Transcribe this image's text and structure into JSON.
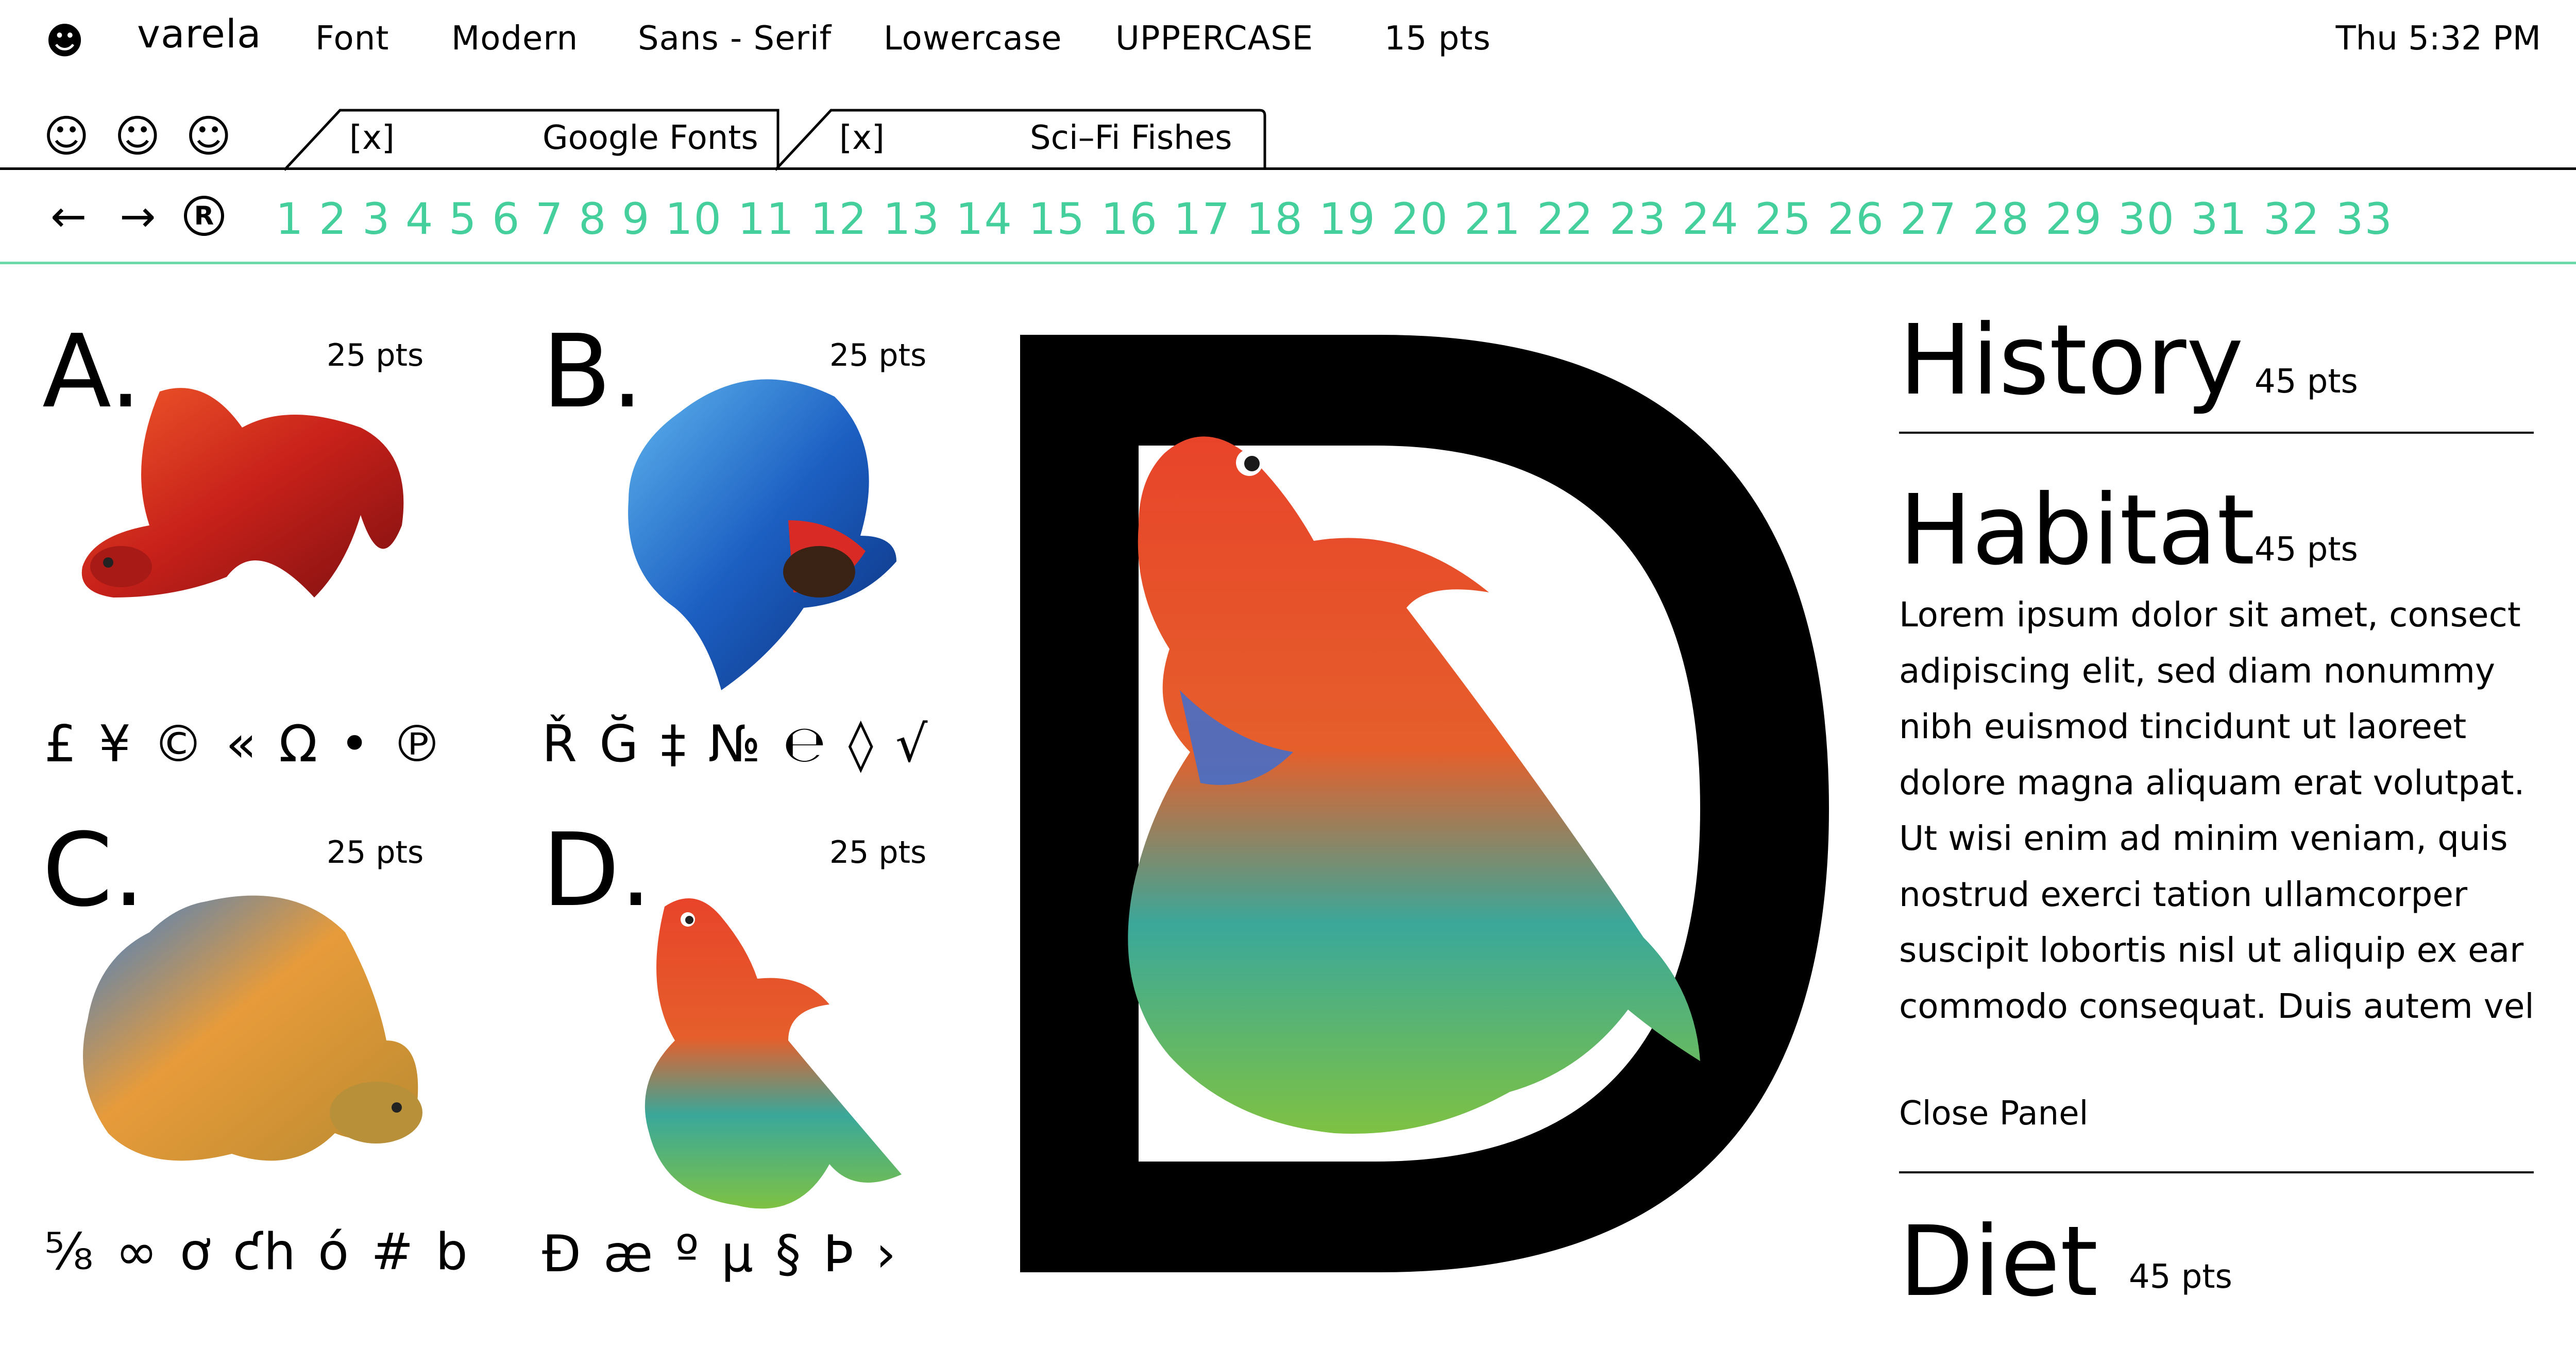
{
  "menubar": {
    "logo_icon": "smiley-face-icon",
    "app_name": "varela",
    "items": [
      "Font",
      "Modern",
      "Sans - Serif",
      "Lowercase",
      "UPPERCASE",
      "15 pts"
    ],
    "clock": "Thu 5:32 PM"
  },
  "toolbar": {
    "emoji_icons": [
      "smiley-icon",
      "smiley-icon",
      "smiley-icon"
    ]
  },
  "tabs": [
    {
      "close": "[x]",
      "label": "Google Fonts"
    },
    {
      "close": "[x]",
      "label": "Sci–Fi Fishes"
    }
  ],
  "nav": {
    "back_glyph": "←",
    "forward_glyph": "→",
    "registered_glyph": "®",
    "pages": [
      "1",
      "2",
      "3",
      "4",
      "5",
      "6",
      "7",
      "8",
      "9",
      "10",
      "11",
      "12",
      "13",
      "14",
      "15",
      "16",
      "17",
      "18",
      "19",
      "20",
      "21",
      "22",
      "23",
      "24",
      "25",
      "26",
      "27",
      "28",
      "29",
      "30",
      "31",
      "32",
      "33"
    ],
    "page_color": "#44cf9c"
  },
  "specimens": [
    {
      "letter": "A.",
      "size": "25 pts",
      "glyphs": "£ ¥ © « Ω • ℗"
    },
    {
      "letter": "B.",
      "size": "25 pts",
      "glyphs": "Ř Ğ ‡ № ℮ ◊ √"
    },
    {
      "letter": "C.",
      "size": "25 pts",
      "glyphs": "⅝ ∞ ơ ƈh ó # b"
    },
    {
      "letter": "D.",
      "size": "25 pts",
      "glyphs": "Đ æ º µ § Þ ›"
    }
  ],
  "feature_letter": "D",
  "panel": {
    "sections": [
      {
        "title": "History",
        "size": "45 pts"
      },
      {
        "title": "Habitat",
        "size": "45 pts"
      },
      {
        "title": "Diet",
        "size": "45 pts"
      }
    ],
    "body": "Lorem ipsum dolor sit amet, consect adipiscing elit, sed diam nonummy nibh euismod tincidunt ut laoreet dolore magna aliquam erat volutpat. Ut wisi enim ad minim veniam, quis nostrud exerci tation ullamcorper suscipit lobortis nisl ut aliquip ex ear commodo consequat. Duis autem vel",
    "close_label": "Close Panel"
  },
  "colors": {
    "accent": "#44cf9c",
    "fish_red": "#d8321f",
    "fish_blue": "#2a6fc9",
    "fish_teal": "#2f9f8f",
    "fish_gold": "#d9a23a"
  }
}
